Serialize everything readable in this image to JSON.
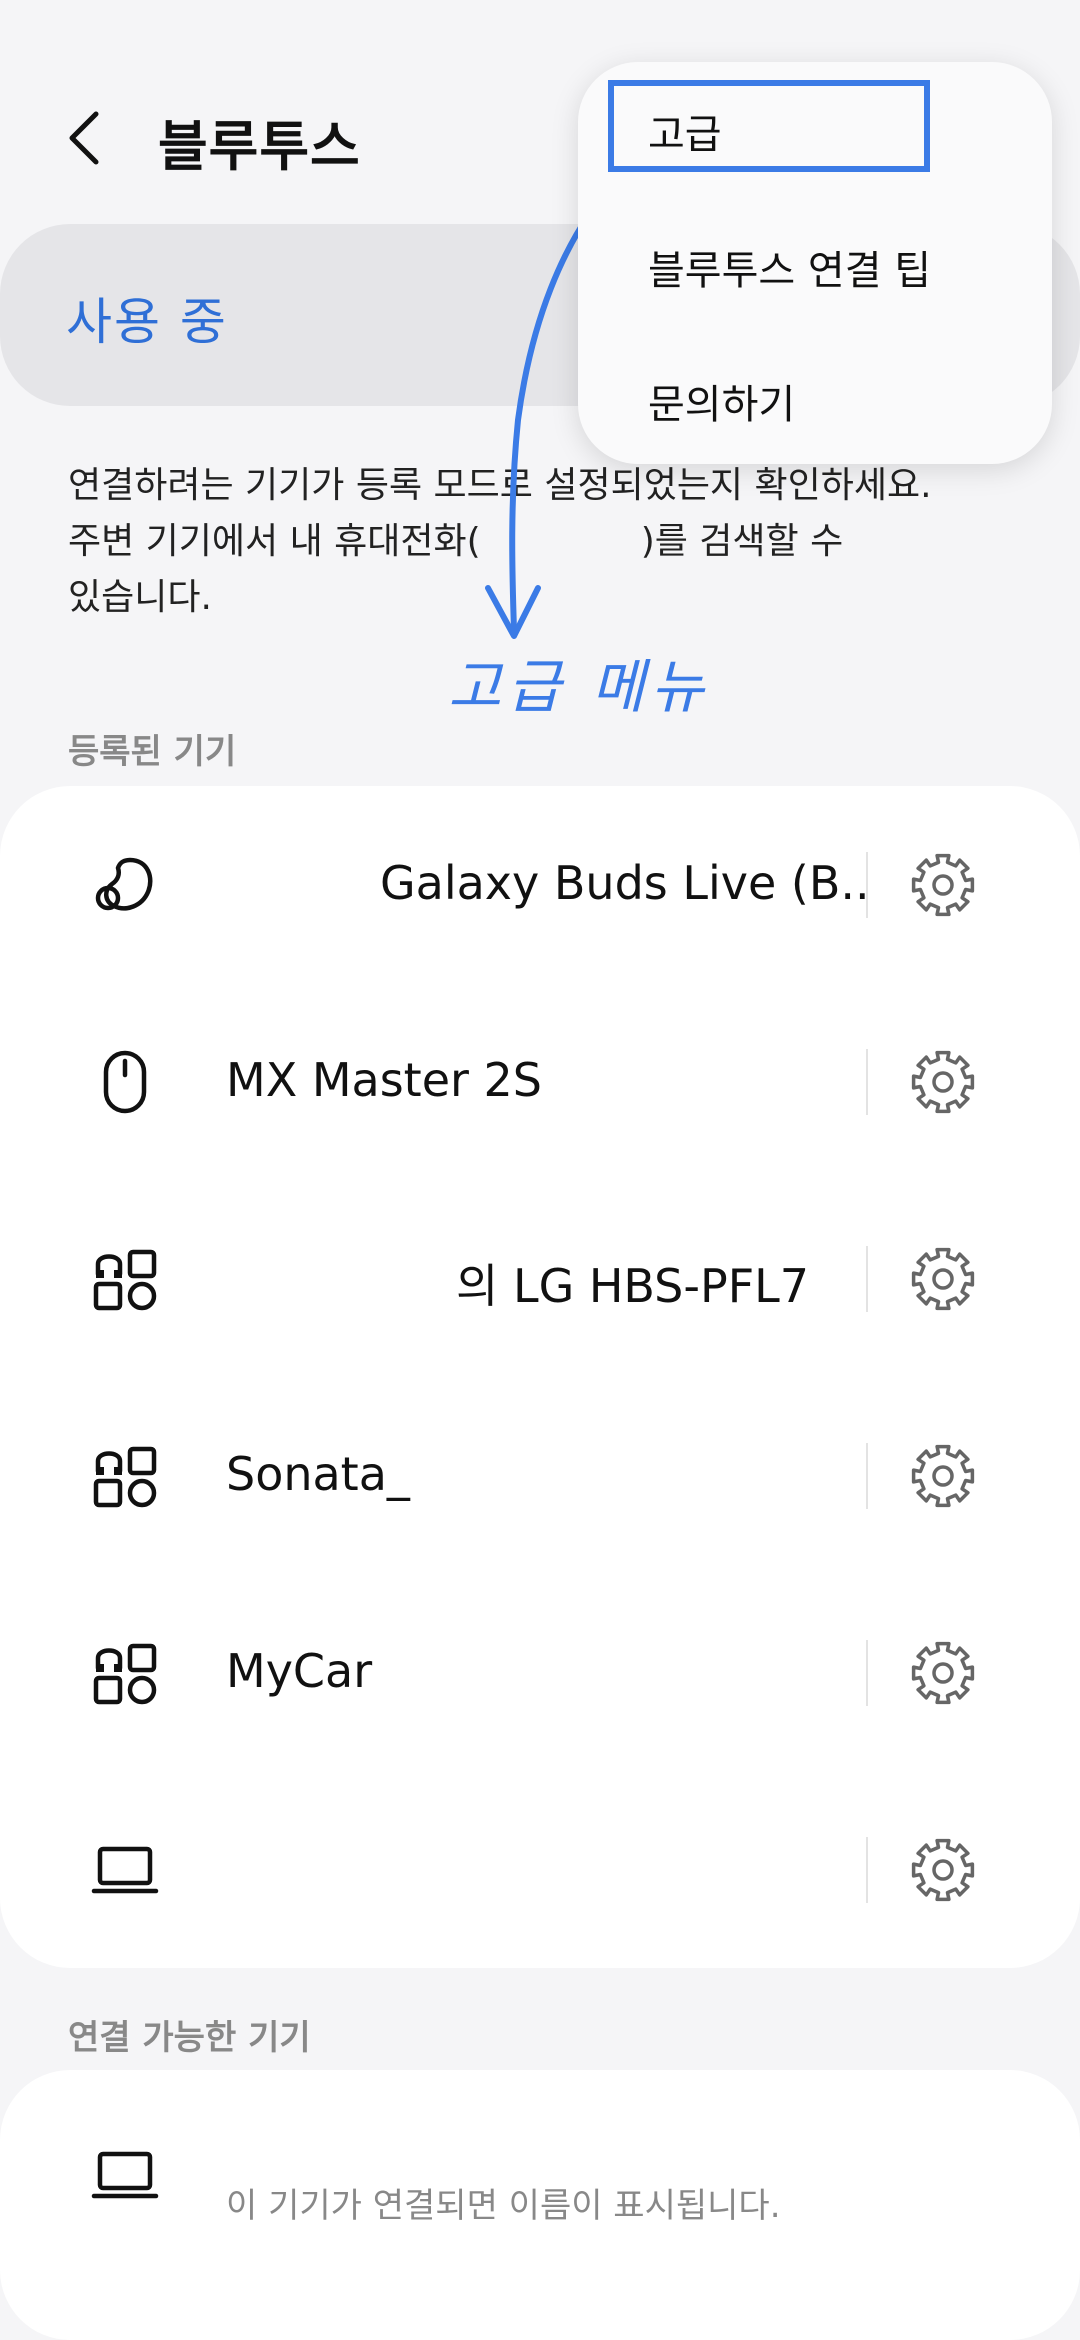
{
  "header": {
    "title": "블루투스",
    "back_icon": "chevron-left-icon"
  },
  "bluetooth_toggle": {
    "label": "사용 중",
    "state": "on"
  },
  "info_text": {
    "line1": "연결하려는 기기가 등록 모드로 설정되었는지 확인하세요.",
    "line2_before": "주변 기기에서 내 휴대전화(",
    "line2_after": ")를 검색할 수",
    "line3": "있습니다."
  },
  "registered": {
    "header": "등록된 기기",
    "devices": [
      {
        "name": "Galaxy Buds Live (B..",
        "icon": "earbuds-icon"
      },
      {
        "name": "MX Master 2S",
        "icon": "mouse-icon"
      },
      {
        "name": "의 LG HBS-PFL7",
        "icon": "audio-device-icon"
      },
      {
        "name": "Sonata_",
        "icon": "audio-device-icon"
      },
      {
        "name": "MyCar",
        "icon": "audio-device-icon"
      },
      {
        "name": "",
        "icon": "laptop-icon"
      }
    ]
  },
  "available": {
    "header": "연결 가능한 기기",
    "devices": [
      {
        "name": "",
        "subtitle": "이 기기가 연결되면 이름이 표시됩니다.",
        "icon": "laptop-icon"
      }
    ]
  },
  "menu": {
    "items": [
      {
        "label": "고급"
      },
      {
        "label": "블루투스 연결 팁"
      },
      {
        "label": "문의하기"
      }
    ]
  },
  "annotation": {
    "text": "고급 메뉴",
    "color": "#3b7be6"
  },
  "colors": {
    "accent": "#2f6fd6",
    "annotation": "#3b7be6"
  }
}
